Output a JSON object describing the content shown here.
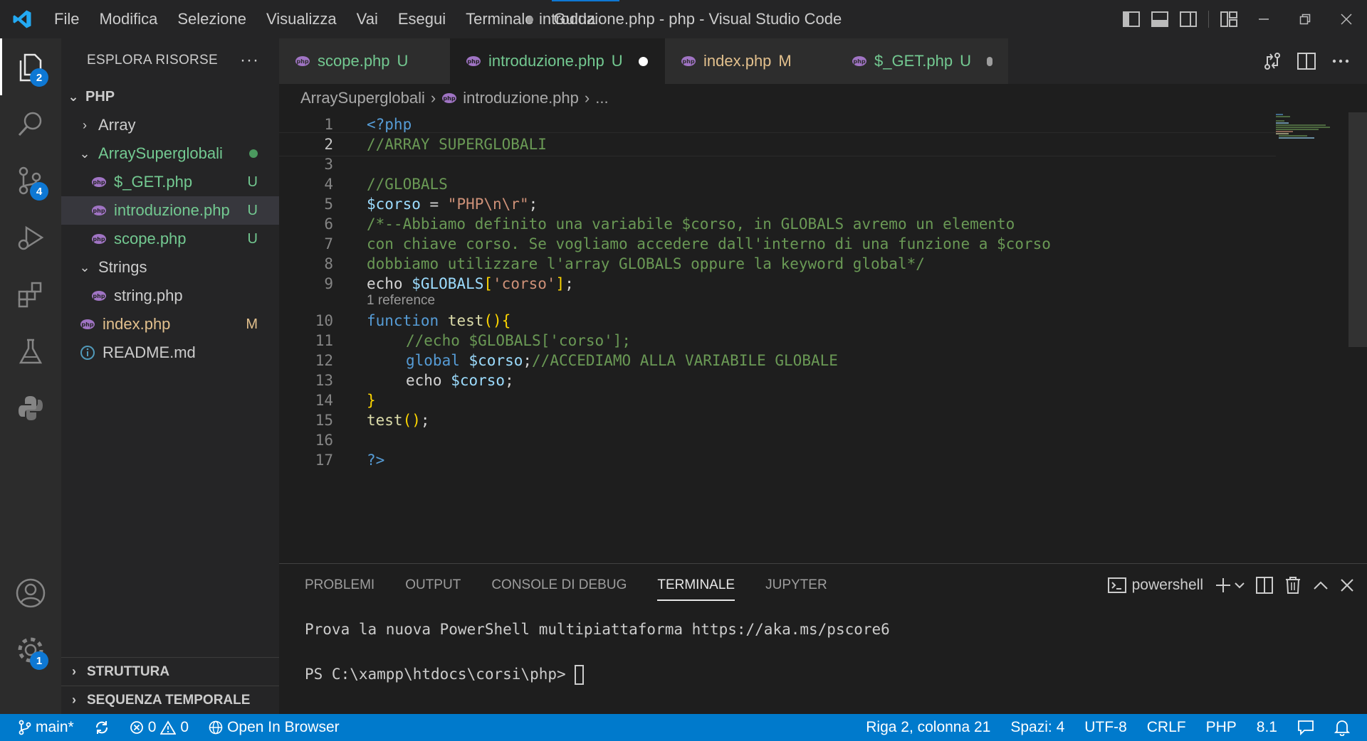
{
  "titlebar": {
    "menu": [
      "File",
      "Modifica",
      "Selezione",
      "Visualizza",
      "Vai",
      "Esegui",
      "Terminale",
      "Guida"
    ],
    "title": "introduzione.php - php - Visual Studio Code",
    "dirty_marker": "●"
  },
  "activitybar": {
    "explorer_badge": "2",
    "scm_badge": "4",
    "settings_badge": "1"
  },
  "sidebar": {
    "header": "ESPLORA RISORSE",
    "more": "···",
    "root": "PHP",
    "items": [
      {
        "label": "Array",
        "status": ""
      },
      {
        "label": "ArraySuperglobali",
        "status": ""
      },
      {
        "label": "$_GET.php",
        "status": "U"
      },
      {
        "label": "introduzione.php",
        "status": "U"
      },
      {
        "label": "scope.php",
        "status": "U"
      },
      {
        "label": "Strings",
        "status": ""
      },
      {
        "label": "string.php",
        "status": ""
      },
      {
        "label": "index.php",
        "status": "M"
      },
      {
        "label": "README.md",
        "status": ""
      }
    ],
    "sections": [
      "STRUTTURA",
      "SEQUENZA TEMPORALE"
    ]
  },
  "tabs": [
    {
      "label": "scope.php",
      "status": "U"
    },
    {
      "label": "introduzione.php",
      "status": "U"
    },
    {
      "label": "index.php",
      "status": "M"
    },
    {
      "label": "$_GET.php",
      "status": "U"
    }
  ],
  "breadcrumb": [
    "ArraySuperglobali",
    "introduzione.php",
    "..."
  ],
  "code": {
    "line_numbers": [
      "1",
      "2",
      "3",
      "4",
      "5",
      "6",
      "7",
      "8",
      "9",
      "10",
      "11",
      "12",
      "13",
      "14",
      "15",
      "16",
      "17"
    ],
    "l1": "<?php",
    "l2": "//ARRAY SUPERGLOBALI",
    "l4": "//GLOBALS",
    "l5_var": "$corso",
    "l5_op": " = ",
    "l5_str": "\"PHP\\n\\r\"",
    "l5_end": ";",
    "l6": "/*--Abbiamo definito una variabile $corso, in GLOBALS avremo un elemento",
    "l7": "con chiave corso. Se vogliamo accedere dall'interno di una funzione a $corso",
    "l8": "dobbiamo utilizzare l'array GLOBALS oppure la keyword global*/",
    "l9_echo": "echo ",
    "l9_var": "$GLOBALS",
    "l9_open": "[",
    "l9_str": "'corso'",
    "l9_close": "]",
    "l9_end": ";",
    "codelens": "1 reference",
    "l10_kw": "function",
    "l10_fn": "test",
    "l10_paren": "()",
    "l10_brace": "{",
    "l11": "//echo $GLOBALS['corso'];",
    "l12_kw": "global",
    "l12_var": "$corso",
    "l12_end": ";",
    "l12_com": "//ACCEDIAMO ALLA VARIABILE GLOBALE",
    "l13_echo": "echo ",
    "l13_var": "$corso",
    "l13_end": ";",
    "l14": "}",
    "l15_fn": "test",
    "l15_paren": "()",
    "l15_end": ";",
    "l17": "?>"
  },
  "panel": {
    "tabs": [
      "PROBLEMI",
      "OUTPUT",
      "CONSOLE DI DEBUG",
      "TERMINALE",
      "JUPYTER"
    ],
    "shell": "powershell",
    "terminal_line1": "Prova la nuova PowerShell multipiattaforma https://aka.ms/pscore6",
    "terminal_prompt": "PS C:\\xampp\\htdocs\\corsi\\php> "
  },
  "statusbar": {
    "branch": "main*",
    "errors": "0",
    "warnings": "0",
    "open_in_browser": "Open In Browser",
    "position": "Riga 2, colonna 21",
    "spaces": "Spazi: 4",
    "encoding": "UTF-8",
    "eol": "CRLF",
    "language": "PHP",
    "version": "8.1"
  },
  "colors": {
    "accent": "#007acc",
    "untracked": "#73c991",
    "modified": "#e2c08d",
    "php_icon": "#a074c4"
  }
}
